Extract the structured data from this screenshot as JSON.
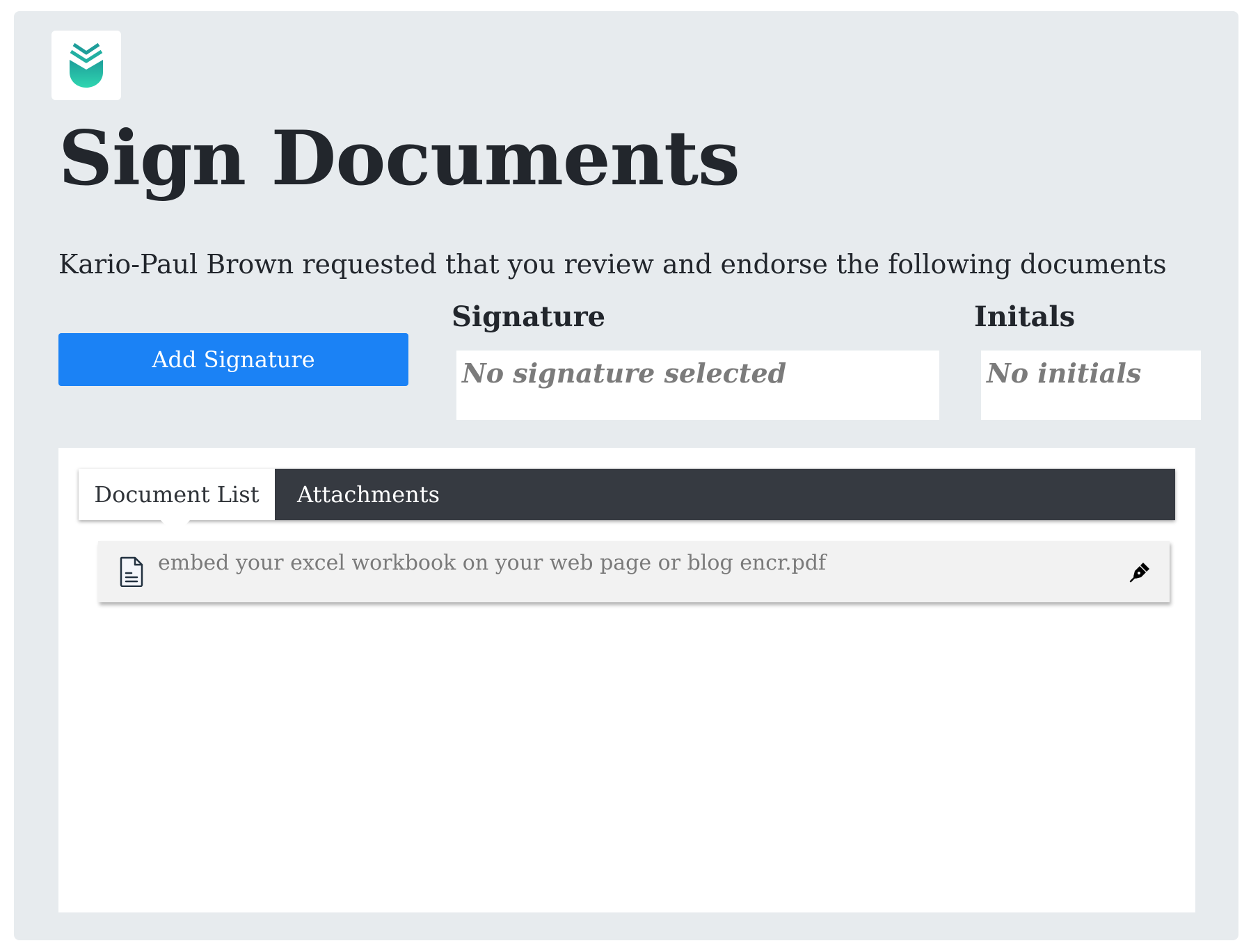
{
  "app": {
    "logo_icon": "leaf-shield-logo-icon",
    "brand_colors": [
      "#1e9e9a",
      "#2fd6b0"
    ]
  },
  "page": {
    "title": "Sign Documents",
    "subtitle": "Kario-Paul Brown requested that you review and endorse the following documents"
  },
  "signature_section": {
    "add_button_label": "Add Signature",
    "add_button_color": "#1b82f5",
    "signature_label": "Signature",
    "signature_value": "No signature selected",
    "initials_label": "Initals",
    "initials_value": "No initials"
  },
  "tabs": [
    {
      "label": "Document List",
      "active": true
    },
    {
      "label": "Attachments",
      "active": false
    }
  ],
  "documents": [
    {
      "name": "embed your excel workbook on your web page or blog encr.pdf",
      "icon": "file-text-icon",
      "action_icon": "pen-nib-icon"
    }
  ]
}
